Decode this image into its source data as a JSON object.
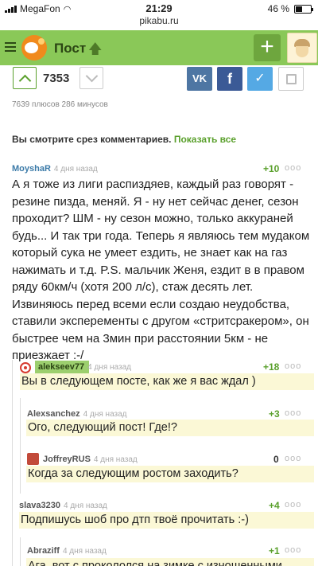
{
  "status_bar": {
    "carrier": "MegaFon",
    "time": "21:29",
    "url": "pikabu.ru",
    "battery": "46 %",
    "battery_level": 0.46
  },
  "header": {
    "title": "Пост",
    "title_icon": "arrow-up-icon",
    "add_label": "+",
    "colors": {
      "bar": "#8ac858",
      "button": "#6ea63e",
      "accent": "#5aa02c"
    }
  },
  "post": {
    "rating": "7353",
    "votes_info": "7639 плюсов 286 минусов",
    "share": {
      "vk": "VK",
      "fb": "f",
      "tw": "✓"
    }
  },
  "slice": {
    "text": "Вы смотрите срез комментариев.",
    "link": "Показать все"
  },
  "comments": [
    {
      "author": "MoyshaR",
      "date": "4 дня назад",
      "score": "+10",
      "text": "А я тоже из лиги распиздяев, каждый раз говорят - резине пизда, меняй. Я - ну нет сейчас денег, сезон проходит? ШМ - ну сезон можно, только аккураней будь... И так три года. Теперь я являюсь тем мудаком который сука не умеет ездить, не знает как на газ нажимать и т.д. P.S. мальчик Женя, ездит в в правом ряду 60км/ч (хотя 200 л/с), стаж десять лет. Извиняюсь перед всеми если создаю неудобства, ставили эксперементы с другом «стритсракером», он быстрее чем на 3мин при расстоянии 5км - не приезжает :-/"
    },
    {
      "author": "alekseev77",
      "date": "4 дня назад",
      "score": "+18",
      "text": "Вы в следующем посте, как же я вас ждал )"
    },
    {
      "author": "Alexsanchez",
      "date": "4 дня назад",
      "score": "+3",
      "text": "Ого, следующий пост! Где!?"
    },
    {
      "author": "JoffreyRUS",
      "date": "4 дня назад",
      "score": "0",
      "text": "Когда за следующим ростом заходить?"
    },
    {
      "author": "slava3230",
      "date": "4 дня назад",
      "score": "+4",
      "text": "Подпишусь шоб про дтп твоё прочитать :-)"
    },
    {
      "author": "Abraziff",
      "date": "4 дня назад",
      "score": "+1",
      "text": "Ага, вот с прокололся на зимке с изношенными"
    }
  ],
  "more_icon": "ooo"
}
